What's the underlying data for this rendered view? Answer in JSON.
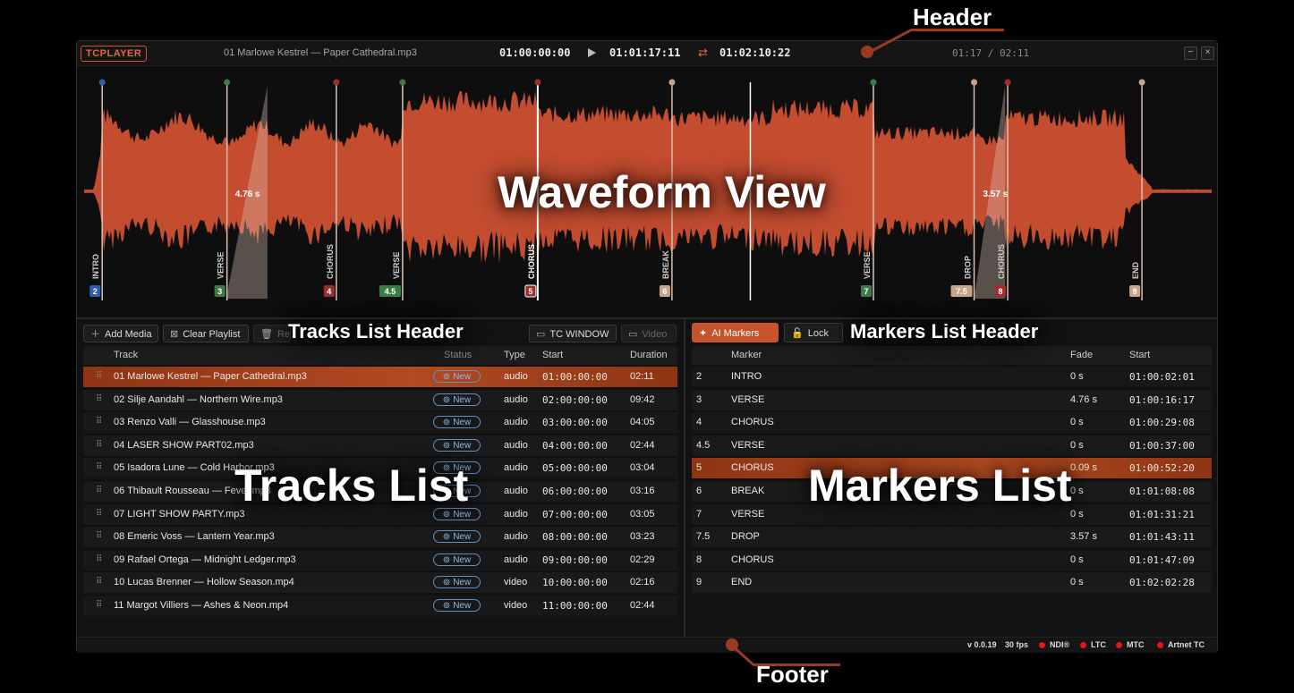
{
  "annotations": {
    "header": "Header",
    "waveform": "Waveform View",
    "tracks_header": "Tracks List Header",
    "markers_header": "Markers List Header",
    "tracks_list": "Tracks List",
    "markers_list": "Markers List",
    "footer": "Footer"
  },
  "header": {
    "logo": "TCPLAYER",
    "filename": "01 Marlowe Kestrel — Paper Cathedral.mp3",
    "tc_start": "01:00:00:00",
    "tc_current": "01:01:17:11",
    "tc_end": "01:02:10:22",
    "elapsed": "01:17 / 02:11",
    "minimize": "−",
    "close": "×",
    "icons": {
      "play": "play-icon",
      "loop": "loop-icon"
    }
  },
  "waveform": {
    "color": "#c44d30",
    "duration_s": 131,
    "fades": [
      {
        "label": "4.76 s",
        "start_s": 16.5,
        "end_s": 21.3,
        "marker": "3"
      },
      {
        "label": "3.57 s",
        "start_s": 103.4,
        "end_s": 107.0,
        "marker": "7.5"
      }
    ],
    "markers": [
      {
        "num": "2",
        "label": "INTRO",
        "time_s": 2.1,
        "color": "#2f5fa8"
      },
      {
        "num": "3",
        "label": "VERSE",
        "time_s": 16.6,
        "color": "#3d7a45"
      },
      {
        "num": "4",
        "label": "CHORUS",
        "time_s": 29.3,
        "color": "#9e2e2e"
      },
      {
        "num": "4.5",
        "label": "VERSE",
        "time_s": 37.0,
        "color": "#3d7a45"
      },
      {
        "num": "5",
        "label": "CHORUS",
        "time_s": 52.7,
        "color": "#9e2e2e",
        "selected": true
      },
      {
        "num": "6",
        "label": "BREAK",
        "time_s": 68.3,
        "color": "#c8a48a"
      },
      {
        "num": "7",
        "label": "VERSE",
        "time_s": 91.7,
        "color": "#3d7a45"
      },
      {
        "num": "7.5",
        "label": "DROP",
        "time_s": 103.4,
        "color": "#c8a48a"
      },
      {
        "num": "8",
        "label": "CHORUS",
        "time_s": 107.3,
        "color": "#9e2e2e"
      },
      {
        "num": "9",
        "label": "END",
        "time_s": 122.9,
        "color": "#c8a48a"
      }
    ],
    "playhead_s": 77.4
  },
  "tracks_toolbar": {
    "add_media": "Add Media",
    "clear_playlist": "Clear Playlist",
    "remove": "Rem",
    "tc_window": "TC WINDOW",
    "video": "Video"
  },
  "tracks": {
    "columns": [
      "Track",
      "Status",
      "Type",
      "Start",
      "Duration"
    ],
    "rows": [
      {
        "name": "01 Marlowe Kestrel — Paper Cathedral.mp3",
        "status": "New",
        "type": "audio",
        "start": "01:00:00:00",
        "duration": "02:11",
        "selected": true
      },
      {
        "name": "02 Silje Aandahl — Northern Wire.mp3",
        "status": "New",
        "type": "audio",
        "start": "02:00:00:00",
        "duration": "09:42"
      },
      {
        "name": "03 Renzo Valli — Glasshouse.mp3",
        "status": "New",
        "type": "audio",
        "start": "03:00:00:00",
        "duration": "04:05"
      },
      {
        "name": "04 LASER SHOW PART02.mp3",
        "status": "New",
        "type": "audio",
        "start": "04:00:00:00",
        "duration": "02:44"
      },
      {
        "name": "05 Isadora Lune — Cold Harbor.mp3",
        "status": "New",
        "type": "audio",
        "start": "05:00:00:00",
        "duration": "03:04"
      },
      {
        "name": "06 Thibault Rousseau — Fever.mp3",
        "status": "New",
        "type": "audio",
        "start": "06:00:00:00",
        "duration": "03:16"
      },
      {
        "name": "07 LIGHT SHOW PARTY.mp3",
        "status": "New",
        "type": "audio",
        "start": "07:00:00:00",
        "duration": "03:05"
      },
      {
        "name": "08 Emeric Voss — Lantern Year.mp3",
        "status": "New",
        "type": "audio",
        "start": "08:00:00:00",
        "duration": "03:23"
      },
      {
        "name": "09 Rafael Ortega — Midnight Ledger.mp3",
        "status": "New",
        "type": "audio",
        "start": "09:00:00:00",
        "duration": "02:29"
      },
      {
        "name": "10 Lucas Brenner — Hollow Season.mp4",
        "status": "New",
        "type": "video",
        "start": "10:00:00:00",
        "duration": "02:16"
      },
      {
        "name": "11 Margot Villiers — Ashes & Neon.mp4",
        "status": "New",
        "type": "video",
        "start": "11:00:00:00",
        "duration": "02:44"
      }
    ]
  },
  "markers_toolbar": {
    "ai_markers": "AI Markers",
    "lock": "Lock"
  },
  "markers": {
    "columns": [
      "Marker",
      "Fade",
      "Start"
    ],
    "rows": [
      {
        "num": "2",
        "name": "INTRO",
        "fade": "0 s",
        "start": "01:00:02:01"
      },
      {
        "num": "3",
        "name": "VERSE",
        "fade": "4.76 s",
        "start": "01:00:16:17"
      },
      {
        "num": "4",
        "name": "CHORUS",
        "fade": "0 s",
        "start": "01:00:29:08"
      },
      {
        "num": "4.5",
        "name": "VERSE",
        "fade": "0 s",
        "start": "01:00:37:00"
      },
      {
        "num": "5",
        "name": "CHORUS",
        "fade": "0.09 s",
        "start": "01:00:52:20",
        "selected": true
      },
      {
        "num": "6",
        "name": "BREAK",
        "fade": "0 s",
        "start": "01:01:08:08"
      },
      {
        "num": "7",
        "name": "VERSE",
        "fade": "0 s",
        "start": "01:01:31:21"
      },
      {
        "num": "7.5",
        "name": "DROP",
        "fade": "3.57 s",
        "start": "01:01:43:11"
      },
      {
        "num": "8",
        "name": "CHORUS",
        "fade": "0 s",
        "start": "01:01:47:09"
      },
      {
        "num": "9",
        "name": "END",
        "fade": "0 s",
        "start": "01:02:02:28"
      }
    ]
  },
  "footer": {
    "version": "v 0.0.19",
    "fps": "30 fps",
    "outputs": [
      "NDI®",
      "LTC",
      "MTC",
      "Artnet TC"
    ],
    "status_color": "#e0181b"
  }
}
